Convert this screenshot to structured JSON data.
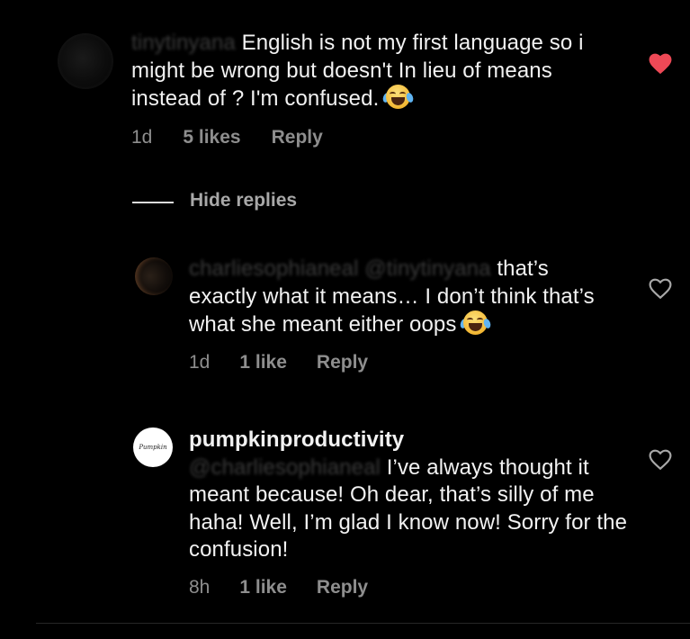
{
  "comment": {
    "username": "tinytinyana",
    "text": "English is not my first language so i might be wrong but doesn't In lieu of means instead of ? I'm confused.",
    "emoji": "face-with-tears-of-joy",
    "time": "1d",
    "likes": "5 likes",
    "reply_label": "Reply",
    "liked": true,
    "like_color": "#ed4956"
  },
  "hide_replies_label": "Hide replies",
  "replies": [
    {
      "username": "charliesophianeal",
      "mention": "@tinytinyana",
      "text": "that’s exactly what it means… I don’t think that’s what she meant either oops",
      "emoji": "face-with-tears-of-joy",
      "time": "1d",
      "likes": "1 like",
      "reply_label": "Reply",
      "liked": false
    },
    {
      "username": "pumpkinproductivity",
      "avatar_text": "Pumpkin",
      "mention": "@charliesophianeal",
      "text": "I’ve always thought it meant because! Oh dear, that’s silly of me haha! Well, I’m glad I know now! Sorry for the confusion!",
      "time": "8h",
      "likes": "1 like",
      "reply_label": "Reply",
      "liked": false
    }
  ],
  "colors": {
    "background": "#000000",
    "text": "#f2f2f2",
    "meta": "#8e8e8e",
    "heart_filled": "#ed4956"
  }
}
